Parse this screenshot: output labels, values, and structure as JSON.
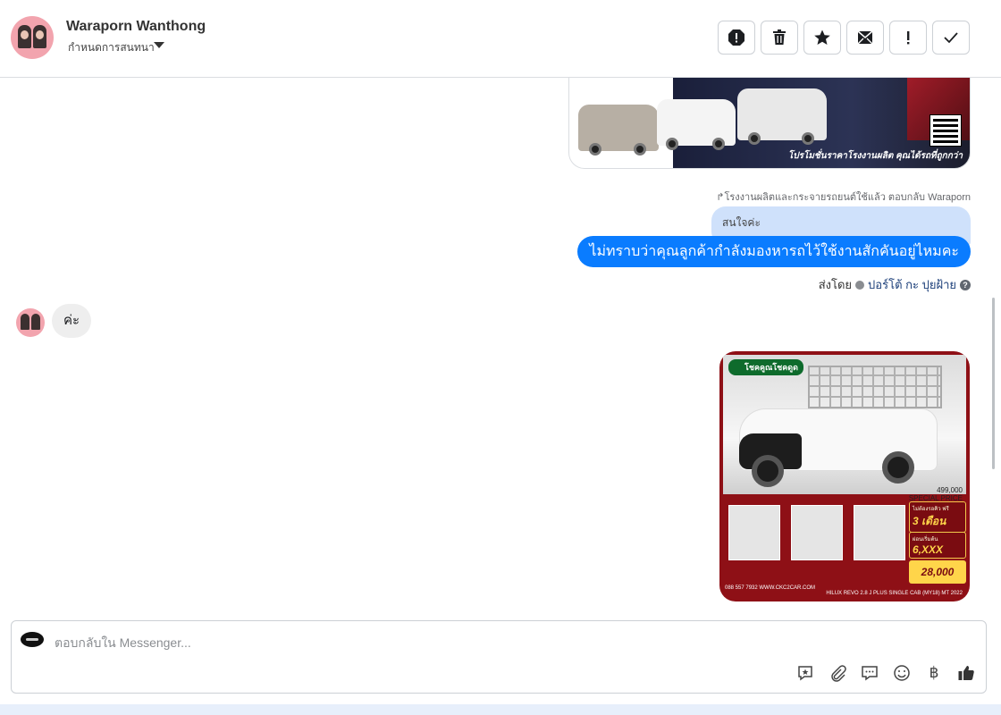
{
  "header": {
    "contact_name": "Waraporn Wanthong",
    "conversation_action": "กำหนดการสนทนา",
    "toolbar_icons": [
      "spam-icon",
      "trash-icon",
      "star-icon",
      "mark-unread-icon",
      "important-icon",
      "done-icon"
    ]
  },
  "messages": {
    "ad_image_tagline": "โปรโมชั่นราคาโรงงานผลิต คุณได้รถที่ถูกกว่า",
    "reply_note": "โรงงานผลิตและกระจายรถยนต์ใช้แล้ว ตอบกลับ Waraporn",
    "quoted_text": "สนใจค่ะ",
    "outgoing_text": "ไม่ทราบว่าคุณลูกค้ากำลังมองหารถไว้ใช้งานสักคันอยู่ไหมคะ",
    "sent_by_label": "ส่งโดย",
    "sent_by_user": "ปอร์โต้ กะ ปุยฝ้าย",
    "incoming_text": "ค่ะ"
  },
  "product_image": {
    "brand": "โชคคูณโชคดูด",
    "price": "499,000",
    "price_caption": "SPECIAL PRICE",
    "promo_1_caption": "ไม่ต้องรอคิว ฟรี",
    "promo_1_value": "3 เดือน",
    "promo_2_caption": "ผ่อนเริ่มต้น",
    "promo_2_value": "6,XXX",
    "promo_3_value": "28,000",
    "footer_contact": "088 557 7932  WWW.CKC2CAR.COM",
    "footer_model": "HILUX REVO 2.8 J PLUS SINGLE CAB (MY18) MT 2022"
  },
  "composer": {
    "placeholder": "ตอบกลับใน Messenger...",
    "baht_symbol": "฿",
    "icons": [
      "saved-reply-icon",
      "attachment-icon",
      "message-icon",
      "emoji-icon",
      "baht-icon",
      "like-icon"
    ]
  },
  "colors": {
    "outgoing_bubble": "#0a7cff",
    "quoted_bubble": "#cfe1fb",
    "incoming_bubble": "#eeeeee",
    "avatar_bg": "#f2a4ae"
  }
}
